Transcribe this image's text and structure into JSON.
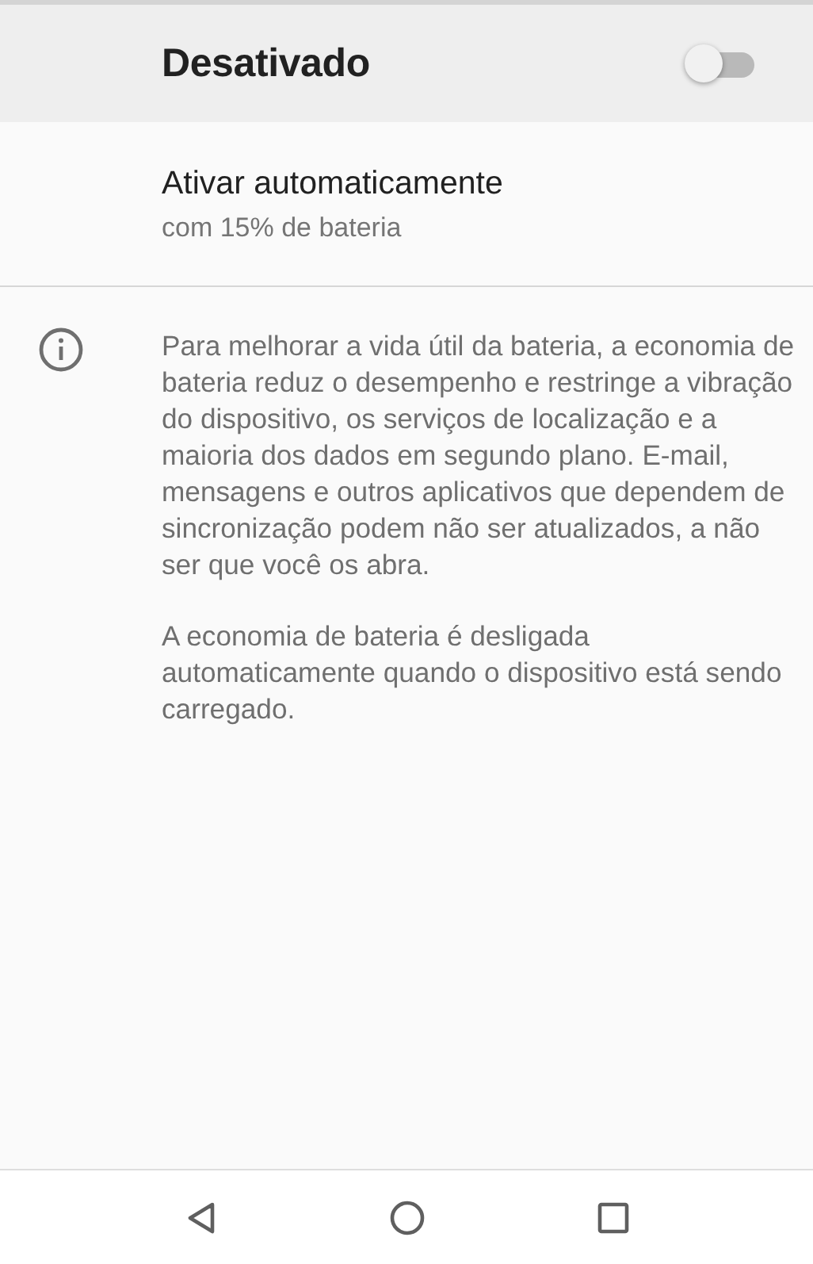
{
  "master_switch": {
    "label": "Desativado",
    "on": false
  },
  "auto_item": {
    "title": "Ativar automaticamente",
    "summary": "com 15% de bateria"
  },
  "info": {
    "paragraphs": [
      "Para melhorar a vida útil da bateria, a economia de bateria reduz o desempenho e restringe a vibração do dispositivo, os serviços de localização e a maioria dos dados em segundo plano. E-mail, mensagens e outros aplicativos que dependem de sincronização podem não ser atualizados, a não ser que você os abra.",
      "A economia de bateria é desligada automaticamente quando o dispositivo está sendo carregado."
    ]
  },
  "nav_bar": {
    "buttons": [
      {
        "kind": "back"
      },
      {
        "kind": "home"
      },
      {
        "kind": "recents"
      }
    ]
  }
}
